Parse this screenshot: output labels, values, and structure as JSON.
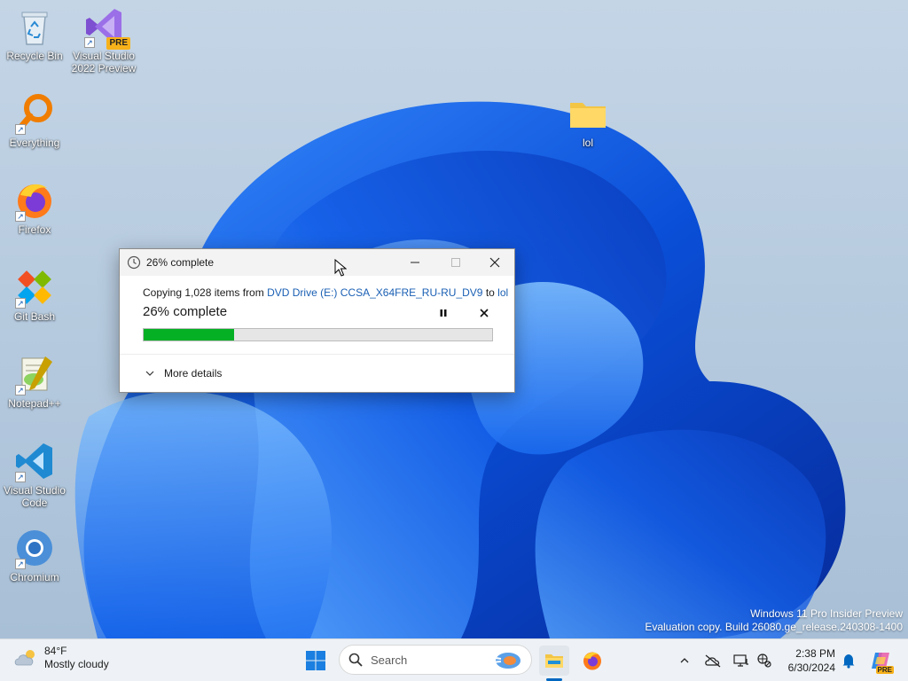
{
  "desktop": {
    "icons": [
      {
        "label": "Recycle Bin",
        "icon": "recycle-bin-icon"
      },
      {
        "label": "Visual Studio 2022 Preview",
        "icon": "visual-studio-preview-icon",
        "badge": "PRE"
      },
      {
        "label": "Everything",
        "icon": "everything-search-icon"
      },
      {
        "label": "Firefox",
        "icon": "firefox-icon"
      },
      {
        "label": "Git Bash",
        "icon": "git-bash-icon"
      },
      {
        "label": "Notepad++",
        "icon": "notepad-plus-plus-icon"
      },
      {
        "label": "Visual Studio Code",
        "icon": "vscode-icon"
      },
      {
        "label": "Chromium",
        "icon": "chromium-icon"
      },
      {
        "label": "lol",
        "icon": "folder-icon"
      }
    ],
    "shortcut_arrow": "↗",
    "watermark": {
      "line1": "Windows 11 Pro Insider Preview",
      "line2": "Evaluation copy. Build 26080.ge_release.240308-1400"
    }
  },
  "dialog": {
    "title": "26% complete",
    "copy_prefix": "Copying 1,028 items from",
    "source": "DVD Drive (E:) CCSA_X64FRE_RU-RU_DV9",
    "to_word": "to",
    "destination": "lol",
    "status": "26% complete",
    "progress_fraction": 0.26,
    "more_details": "More details",
    "progress_color": "#06b025",
    "link_color": "#1a5fb4"
  },
  "taskbar": {
    "weather": {
      "temp": "84°F",
      "condition": "Mostly cloudy",
      "icon": "cloud-icon"
    },
    "search_placeholder": "Search",
    "pinned": [
      "start-icon",
      "file-explorer-icon",
      "firefox-icon"
    ],
    "tray": [
      "chevron-up-icon",
      "onedrive-off-icon",
      "display-icon",
      "network-icon"
    ],
    "time": "2:38 PM",
    "date": "6/30/2024",
    "copilot_badge": "PRE"
  }
}
